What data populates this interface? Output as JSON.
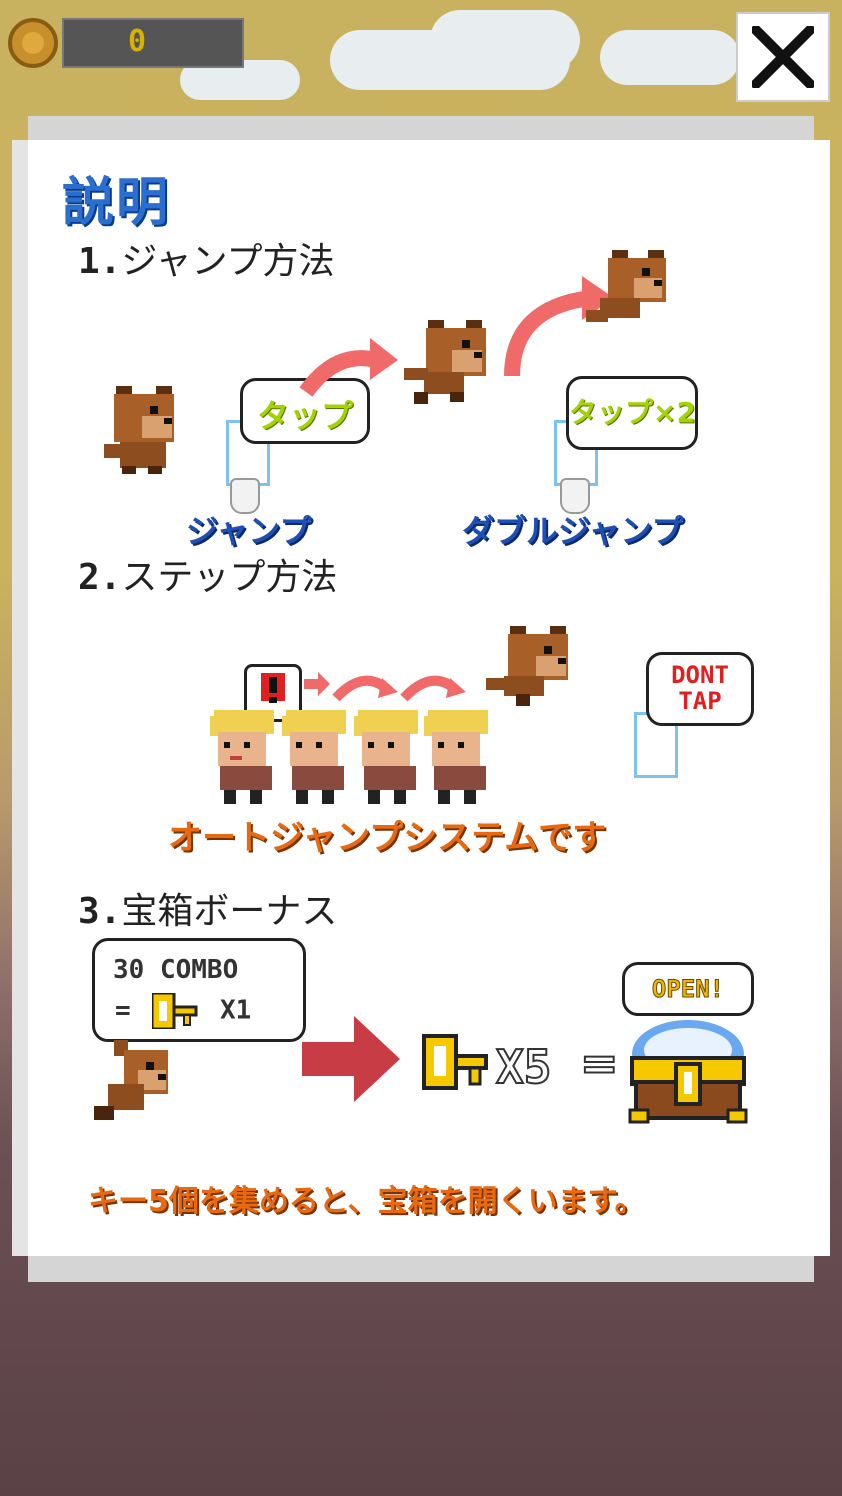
{
  "hud": {
    "coin_count": "0"
  },
  "title": "説明",
  "sections": {
    "jump": {
      "number": "1.",
      "heading": "ジャンプ方法",
      "tap_bubble": "タップ",
      "double_tap_bubble": "タップ×2",
      "jump_label": "ジャンプ",
      "double_jump_label": "ダブルジャンプ"
    },
    "step": {
      "number": "2.",
      "heading": "ステップ方法",
      "dont_tap_bubble_line1": "DONT",
      "dont_tap_bubble_line2": "TAP",
      "auto_jump_caption": "オートジャンプシステムです"
    },
    "chest": {
      "number": "3.",
      "heading": "宝箱ボーナス",
      "combo_line1": "30 COMBO",
      "combo_line2_prefix": "=",
      "combo_line2_suffix": "X1",
      "keys_multiplier": "X5",
      "equals": "=",
      "open_bubble": "OPEN!",
      "caption": "キー5個を集めると、宝箱を開くいます。"
    }
  },
  "colors": {
    "title_blue": "#2a6fd0",
    "label_blue": "#1e4fb4",
    "caption_orange": "#e86a10",
    "arrow_red": "#f06a6a",
    "bubble_green_text": "#a4d400"
  }
}
